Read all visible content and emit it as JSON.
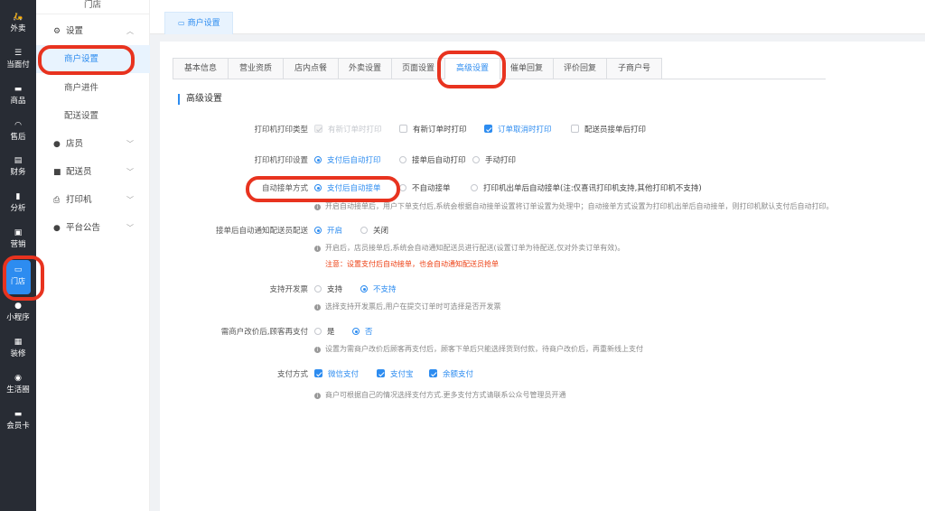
{
  "rail": [
    {
      "icon": "delivery-icon",
      "glyph": "🛵",
      "label": "外卖"
    },
    {
      "icon": "list-icon",
      "glyph": "☰",
      "label": "当面付"
    },
    {
      "icon": "goods-icon",
      "glyph": "▬",
      "label": "商品"
    },
    {
      "icon": "headset-icon",
      "glyph": "◠",
      "label": "售后"
    },
    {
      "icon": "finance-icon",
      "glyph": "▤",
      "label": "财务"
    },
    {
      "icon": "bar-chart-icon",
      "glyph": "▮",
      "label": "分析"
    },
    {
      "icon": "gift-icon",
      "glyph": "▣",
      "label": "营销"
    },
    {
      "icon": "store-icon",
      "glyph": "▭",
      "label": "门店"
    },
    {
      "icon": "wechat-icon",
      "glyph": "●",
      "label": "小程序"
    },
    {
      "icon": "decorate-icon",
      "glyph": "▦",
      "label": "装修"
    },
    {
      "icon": "circle-icon",
      "glyph": "◉",
      "label": "生活圈"
    },
    {
      "icon": "card-icon",
      "glyph": "▬",
      "label": "会员卡"
    }
  ],
  "sidebar": {
    "title": "门店",
    "groups": [
      {
        "icon": "gear-icon",
        "glyph": "⚙",
        "label": "设置",
        "expanded": true
      },
      {
        "icon": "user-icon",
        "glyph": "👤",
        "label": "店员",
        "expanded": false
      },
      {
        "icon": "rider-icon",
        "glyph": "🛵",
        "label": "配送员",
        "expanded": false
      },
      {
        "icon": "printer-icon",
        "glyph": "⎙",
        "label": "打印机",
        "expanded": false
      },
      {
        "icon": "announce-icon",
        "glyph": "👤",
        "label": "平台公告",
        "expanded": false
      }
    ],
    "sub_items": [
      {
        "label": "商户设置",
        "active": true
      },
      {
        "label": "商户进件",
        "active": false
      },
      {
        "label": "配送设置",
        "active": false
      }
    ]
  },
  "top_tab": {
    "icon": "store-icon",
    "glyph": "▭",
    "label": "商户设置"
  },
  "tabs": [
    "基本信息",
    "营业资质",
    "店内点餐",
    "外卖设置",
    "页面设置",
    "高级设置",
    "催单回复",
    "评价回复",
    "子商户号"
  ],
  "active_tab": "高级设置",
  "section_title": "高级设置",
  "form": {
    "printer_type": {
      "label": "打印机打印类型",
      "options": [
        {
          "label": "有新订单时打印",
          "kind": "check",
          "state": "disabled-checked"
        },
        {
          "label": "有新订单时打印",
          "kind": "check",
          "state": "off"
        },
        {
          "label": "订单取消时打印",
          "kind": "check",
          "state": "on"
        },
        {
          "label": "配送员接单后打印",
          "kind": "check",
          "state": "off"
        }
      ]
    },
    "printer_setting": {
      "label": "打印机打印设置",
      "options": [
        {
          "label": "支付后自动打印",
          "state": "on"
        },
        {
          "label": "接单后自动打印",
          "state": "off"
        },
        {
          "label": "手动打印",
          "state": "off"
        }
      ]
    },
    "auto_accept": {
      "label": "自动接单方式",
      "options": [
        {
          "label": "支付后自动接单",
          "state": "on"
        },
        {
          "label": "不自动接单",
          "state": "off"
        },
        {
          "label": "打印机出单后自动接单(注:仅喜讯打印机支持,其他打印机不支持)",
          "state": "off"
        }
      ],
      "hint": "开启自动接单后，用户下单支付后,系统会根据自动接单设置将订单设置为处理中；自动接单方式设置为打印机出单后自动接单，则打印机默认支付后自动打印。"
    },
    "notify_rider": {
      "label": "接单后自动通知配送员配送",
      "options": [
        {
          "label": "开启",
          "state": "on"
        },
        {
          "label": "关闭",
          "state": "off"
        }
      ],
      "hint": "开启后，店员接单后,系统会自动通知配送员进行配送(设置订单为待配送,仅对外卖订单有效)。",
      "warning": "注意：设置支付后自动接单，也会自动通知配送员抢单"
    },
    "invoice": {
      "label": "支持开发票",
      "options": [
        {
          "label": "支持",
          "state": "off"
        },
        {
          "label": "不支持",
          "state": "on"
        }
      ],
      "hint": "选择支持开发票后,用户在提交订单时可选择是否开发票"
    },
    "price_change": {
      "label": "需商户改价后,顾客再支付",
      "options": [
        {
          "label": "是",
          "state": "off"
        },
        {
          "label": "否",
          "state": "on"
        }
      ],
      "hint": "设置为需商户改价后顾客再支付后，顾客下单后只能选择货到付款，待商户改价后，再重新线上支付"
    },
    "payment": {
      "label": "支付方式",
      "options": [
        {
          "label": "微信支付",
          "kind": "check",
          "state": "on"
        },
        {
          "label": "支付宝",
          "kind": "check",
          "state": "on"
        },
        {
          "label": "余额支付",
          "kind": "check",
          "state": "on"
        }
      ],
      "hint": "商户可根据自己的情况选择支付方式.更多支付方式请联系公众号管理员开通"
    }
  },
  "colors": {
    "accent": "#2d8cf0",
    "rail_bg": "#282c34",
    "highlight": "#e8331f",
    "warning": "#ed4014"
  }
}
